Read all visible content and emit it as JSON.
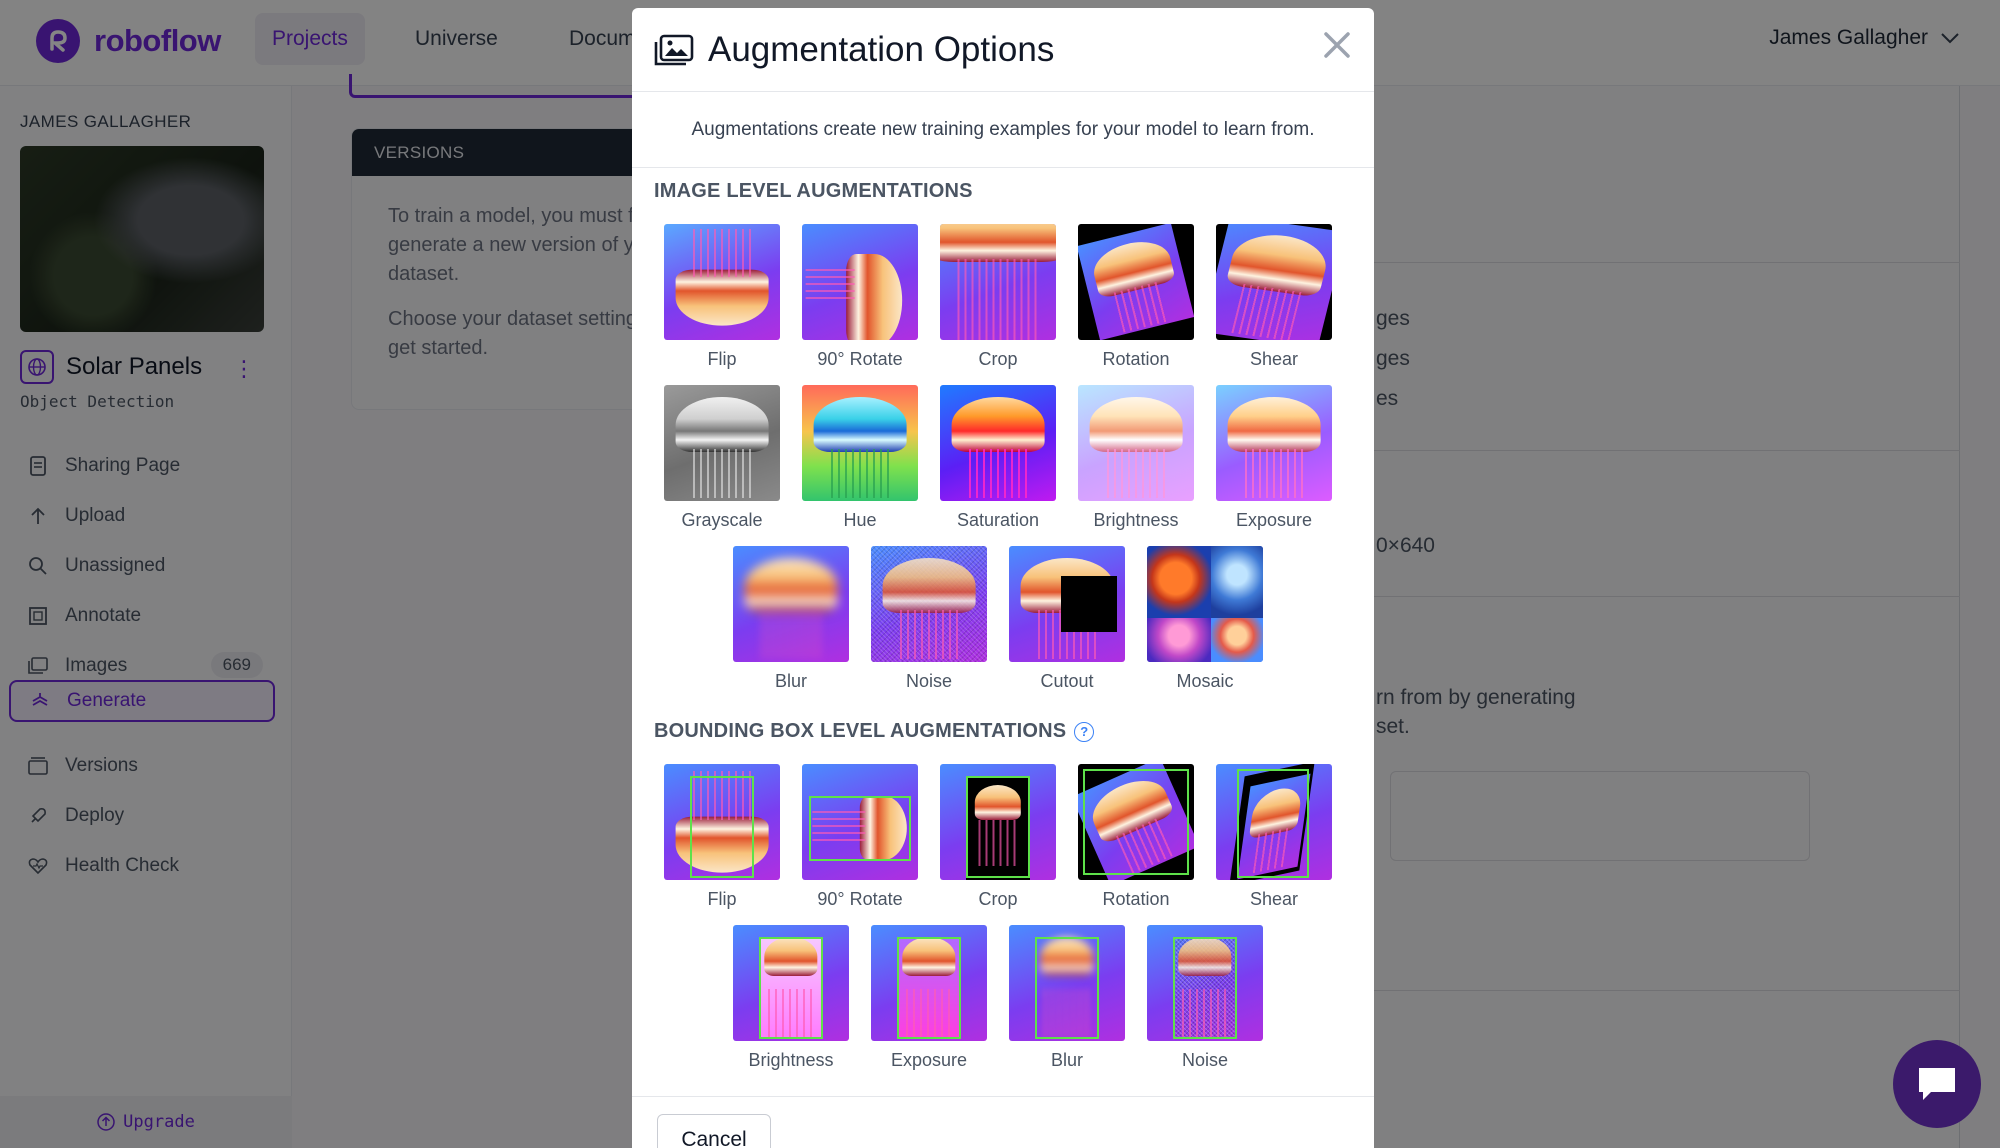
{
  "app": {
    "brand": "roboflow",
    "accent": "#6d28d9"
  },
  "topnav": {
    "items": [
      {
        "label": "Projects",
        "active": true
      },
      {
        "label": "Universe"
      },
      {
        "label": "Documentation"
      }
    ],
    "user": "James Gallagher"
  },
  "sidebar": {
    "owner": "JAMES GALLAGHER",
    "project_name": "Solar Panels",
    "project_type": "Object Detection",
    "items": [
      {
        "label": "Sharing Page",
        "icon": "document-icon"
      },
      {
        "label": "Upload",
        "icon": "arrow-up-icon"
      },
      {
        "label": "Unassigned",
        "icon": "search-icon"
      },
      {
        "label": "Annotate",
        "icon": "annotate-icon"
      },
      {
        "label": "Images",
        "icon": "images-icon",
        "count": "669"
      },
      {
        "label": "Generate",
        "icon": "generate-icon",
        "active": true
      },
      {
        "label": "Versions",
        "icon": "versions-icon"
      },
      {
        "label": "Deploy",
        "icon": "rocket-icon"
      },
      {
        "label": "Health Check",
        "icon": "heart-pulse-icon"
      }
    ],
    "upgrade": "Upgrade"
  },
  "versions_card": {
    "header": "VERSIONS",
    "p1": "To train a model, you must first generate a new version of your dataset.",
    "p2": "Choose your dataset settings to get started."
  },
  "background_panel": {
    "line1": "ges",
    "line2": "ges",
    "line3": "es",
    "resize": "0×640",
    "aug_line1": "rn from by generating",
    "aug_line2": "set."
  },
  "modal": {
    "title": "Augmentation Options",
    "subtitle": "Augmentations create new training examples for your model to learn from.",
    "image_section": "IMAGE LEVEL AUGMENTATIONS",
    "image_augs": [
      "Flip",
      "90° Rotate",
      "Crop",
      "Rotation",
      "Shear",
      "Grayscale",
      "Hue",
      "Saturation",
      "Brightness",
      "Exposure",
      "Blur",
      "Noise",
      "Cutout",
      "Mosaic"
    ],
    "bbox_section": "BOUNDING BOX LEVEL AUGMENTATIONS",
    "bbox_augs": [
      "Flip",
      "90° Rotate",
      "Crop",
      "Rotation",
      "Shear",
      "Brightness",
      "Exposure",
      "Blur",
      "Noise"
    ],
    "cancel": "Cancel"
  }
}
